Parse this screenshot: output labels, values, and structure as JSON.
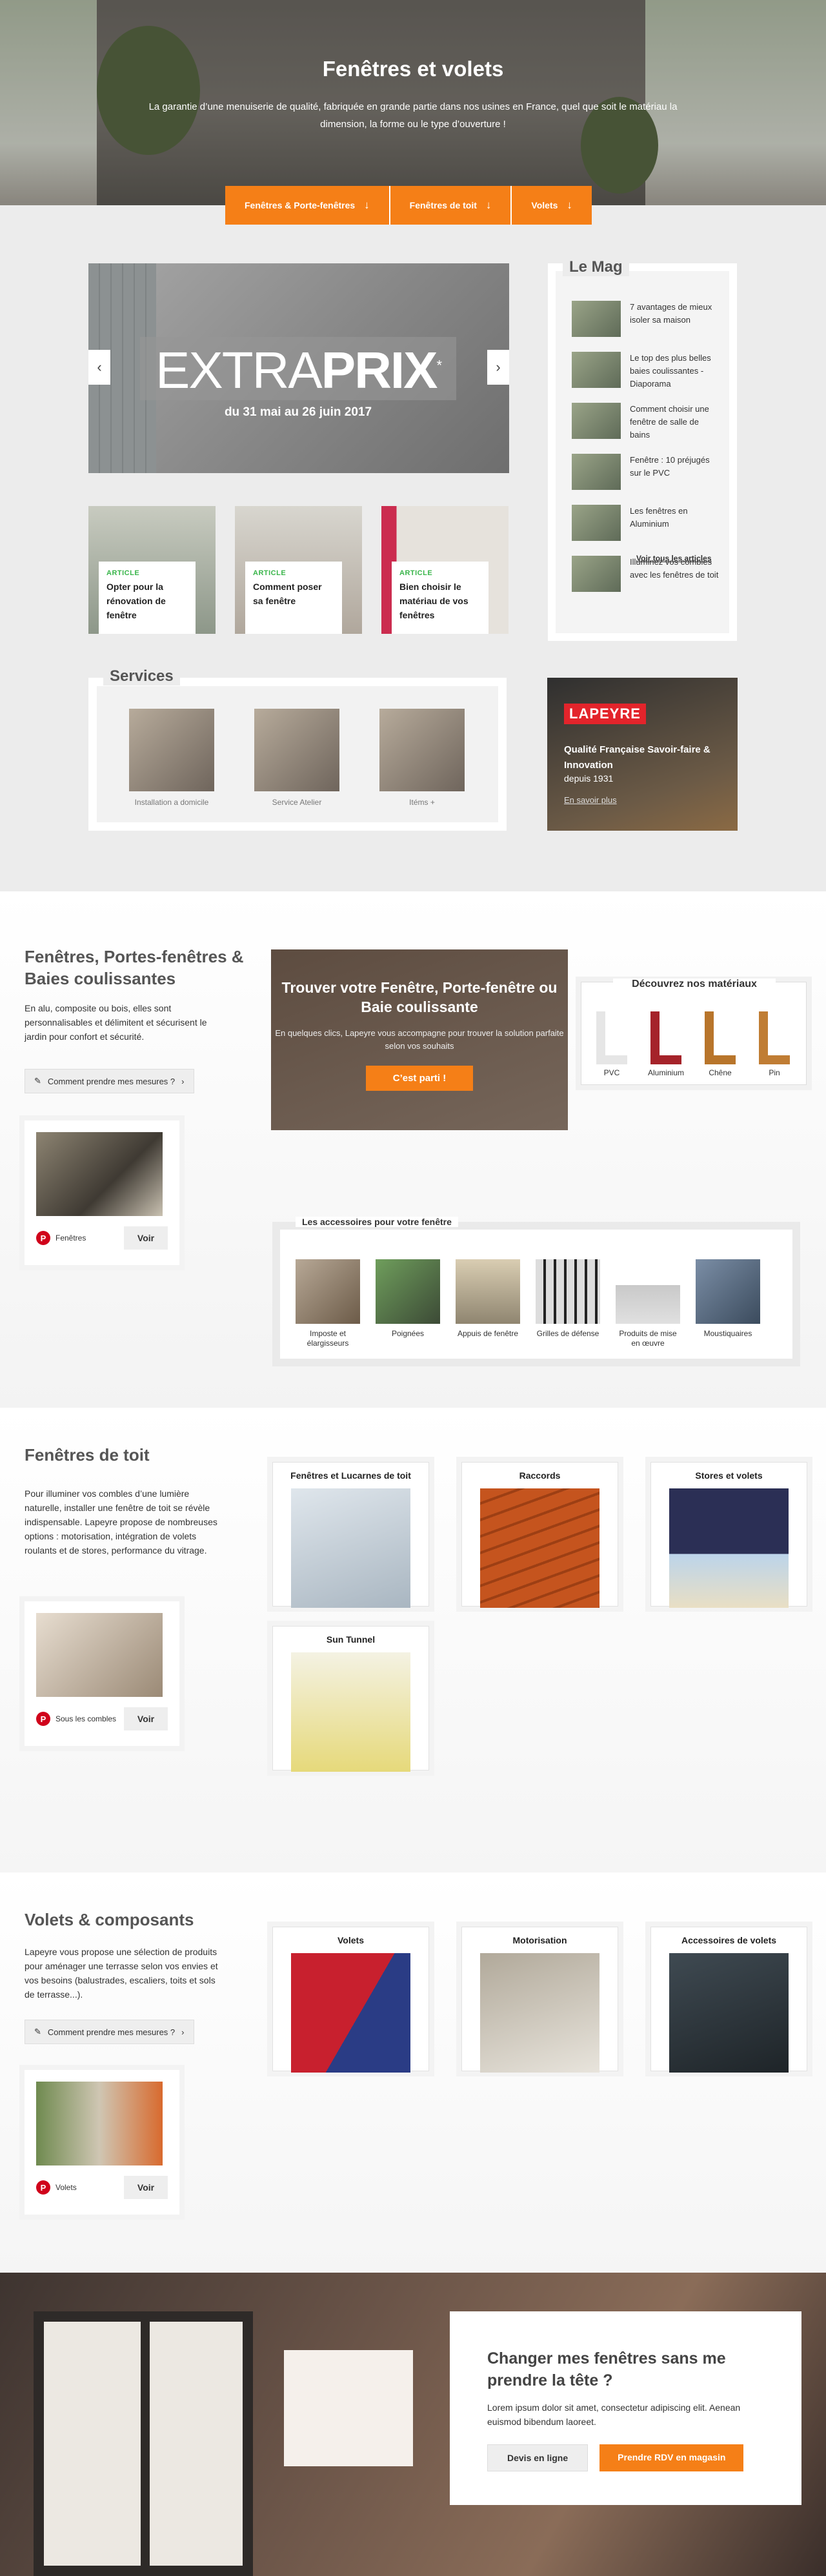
{
  "hero": {
    "title": "Fenêtres et volets",
    "subtitle": "La garantie d’une menuiserie de qualité, fabriquée en grande partie dans nos usines en France, quel que soit le matériau la dimension, la forme ou le type d’ouverture !",
    "tabs": [
      "Fenêtres & Porte-fenêtres",
      "Fenêtres de toit",
      "Volets"
    ]
  },
  "banner": {
    "logo_a": "EXTRA",
    "logo_b": "PRIX",
    "star": "*",
    "dates": "du 31 mai au 26 juin 2017"
  },
  "articles": [
    {
      "tag": "ARTICLE",
      "title": "Opter pour la rénovation de fenêtre"
    },
    {
      "tag": "ARTICLE",
      "title": "Comment poser sa fenêtre"
    },
    {
      "tag": "ARTICLE",
      "title": "Bien choisir le matériau de vos fenêtres"
    }
  ],
  "mag": {
    "title": "Le Mag",
    "items": [
      "7 avantages de mieux isoler sa maison",
      "Le top des plus belles baies coulissantes - Diaporama",
      "Comment choisir une fenêtre de salle de bains",
      "Fenêtre : 10 préjugés sur le PVC",
      "Les fenêtres en Aluminium",
      "Illuminez vos combles avec les fenêtres de toit"
    ],
    "more": "Voir tous les articles"
  },
  "services": {
    "title": "Services",
    "items": [
      "Installation a domicile",
      "Service Atelier",
      "Itéms +"
    ]
  },
  "promo": {
    "logo": "LAPEYRE",
    "line1": "Qualité Française Savoir-faire & Innovation",
    "line2": "depuis 1931",
    "link": "En savoir plus"
  },
  "s2": {
    "title": "Fenêtres, Portes-fenêtres & Baies coulissantes",
    "text": "En alu, composite ou bois, elles sont personnalisables et délimitent et sécurisent le jardin pour confort et sécurité.",
    "measure": "Comment prendre mes mesures ?",
    "pin_label": "Fenêtres",
    "voir": "Voir",
    "find": {
      "title": "Trouver votre Fenêtre, Porte-fenêtre ou Baie coulissante",
      "desc": "En quelques clics, Lapeyre vous accompagne pour trouver la solution parfaite selon vos souhaits",
      "button": "C’est parti !"
    },
    "materials": {
      "title": "Découvrez nos matériaux",
      "items": [
        {
          "label": "PVC",
          "color": "#e8e8e8"
        },
        {
          "label": "Aluminium",
          "color": "#a5232a"
        },
        {
          "label": "Chêne",
          "color": "#b8752b"
        },
        {
          "label": "Pin",
          "color": "#c07d34"
        }
      ]
    },
    "accessories": {
      "title": "Les accessoires pour votre fenêtre",
      "items": [
        "Imposte et élargisseurs",
        "Poignées",
        "Appuis de fenêtre",
        "Grilles de défense",
        "Produits de mise en œuvre",
        "Moustiquaires"
      ]
    }
  },
  "s3": {
    "title": "Fenêtres de toit",
    "text": "Pour illuminer vos combles d’une lumière naturelle, installer une fenêtre de toit se révèle indispensable. Lapeyre propose de nombreuses options : motorisation, intégration de volets roulants et de stores, performance du vitrage.",
    "pin_label": "Sous les combles",
    "voir": "Voir",
    "items": [
      "Fenêtres et Lucarnes de toit",
      "Raccords",
      "Stores et volets",
      "Sun Tunnel"
    ]
  },
  "s4": {
    "title": "Volets & composants",
    "text": "Lapeyre vous propose une sélection de produits pour aménager une terrasse selon vos envies et vos besoins (balustrades, escaliers, toits et sols de terrasse...).",
    "measure": "Comment prendre mes mesures ?",
    "pin_label": "Volets",
    "voir": "Voir",
    "items": [
      "Volets",
      "Motorisation",
      "Accessoires de volets"
    ]
  },
  "cta": {
    "title": "Changer mes fenêtres sans me prendre la tête ?",
    "desc": "Lorem ipsum dolor sit amet, consectetur adipiscing elit. Aenean euismod bibendum laoreet.",
    "btn1": "Devis en ligne",
    "btn2": "Prendre RDV en magasin"
  },
  "colors": {
    "accent": "#f57f17",
    "article_tag": "#39b54a",
    "pinterest": "#d0021b"
  }
}
